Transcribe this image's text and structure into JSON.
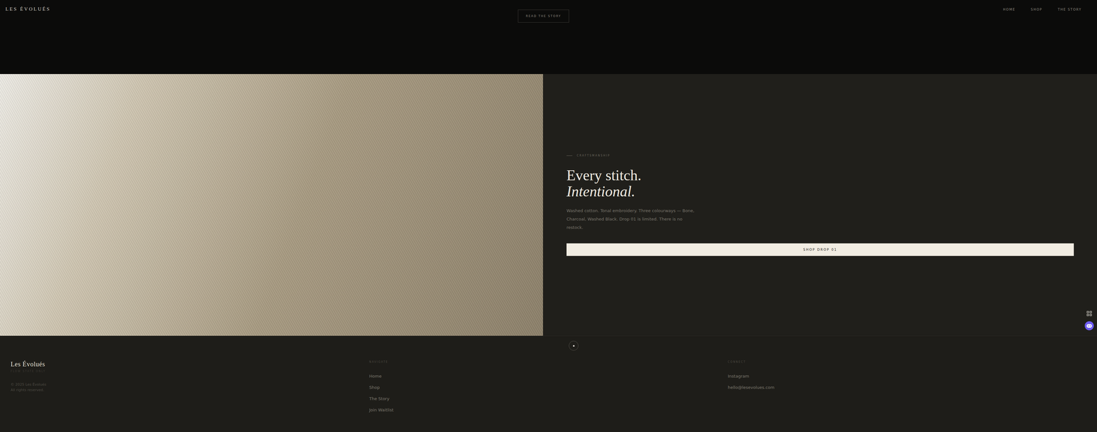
{
  "header": {
    "logo": "LES ÉVOLUÉS",
    "cta": "READ THE STORY",
    "nav": [
      "HOME",
      "SHOP",
      "THE STORY"
    ]
  },
  "hero": {
    "eyebrow": "CRAFTSMANSHIP",
    "title": "Every stitch.",
    "title_italic": "Intentional.",
    "body": "Washed cotton. Tonal embroidery. Three colourways — Bone, Charcoal, Washed Black. Drop 01 is limited. There is no restock.",
    "button": "SHOP DROP 01"
  },
  "footer": {
    "brand": "Les Évolués",
    "tagline": "FLOW STATE ONLY",
    "copyright": "© 2025 Les Évolués",
    "rights": "All rights reserved.",
    "columns": [
      {
        "heading": "NAVIGATE",
        "links": [
          "Home",
          "Shop",
          "The Story",
          "Join Waitlist"
        ]
      },
      {
        "heading": "CONNECT",
        "links": [
          "Instagram",
          "hello@lesevolues.com"
        ]
      }
    ]
  }
}
